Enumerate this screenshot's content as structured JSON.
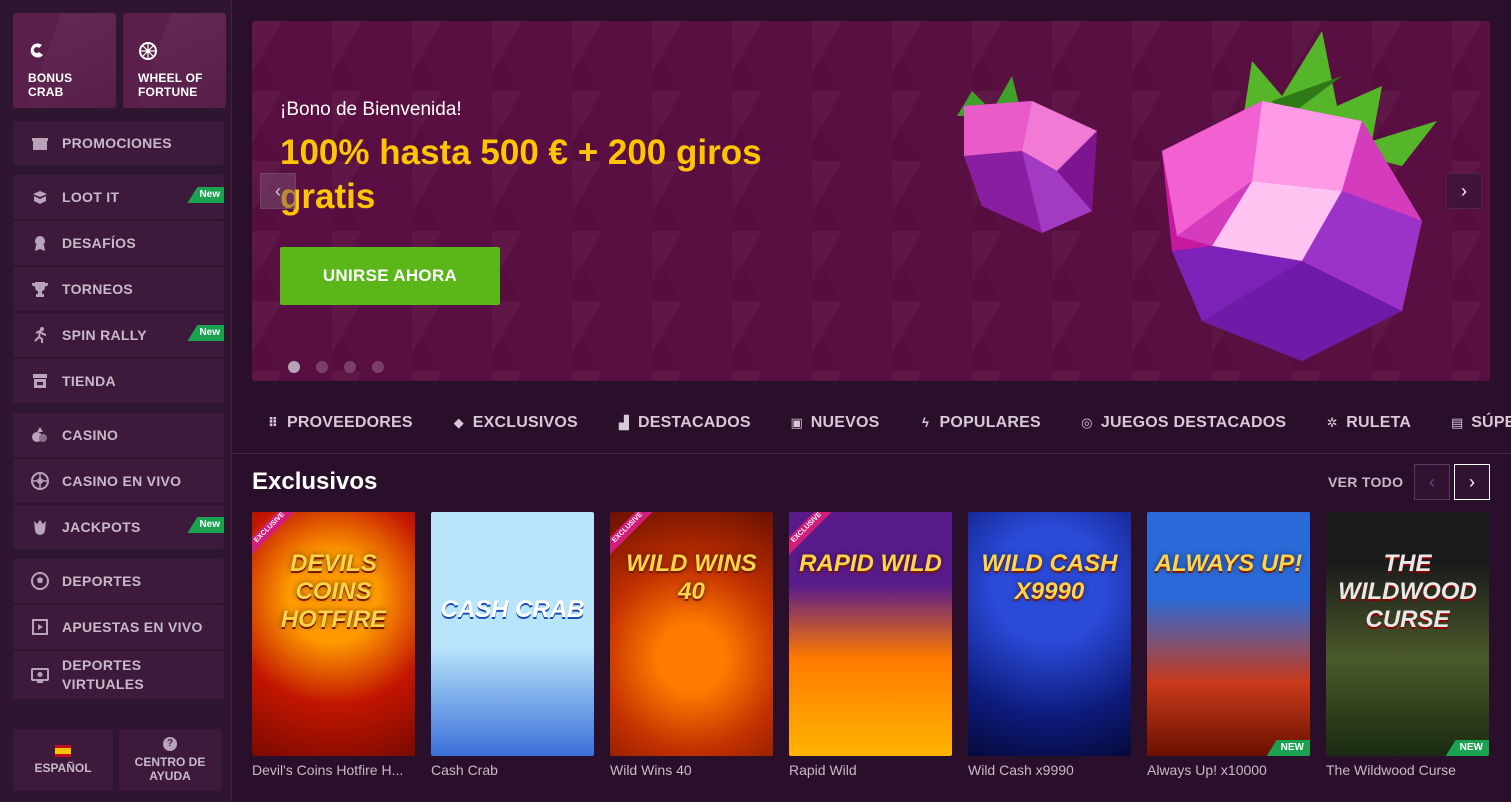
{
  "sidebar": {
    "top_tiles": [
      {
        "label": "BONUS CRAB",
        "icon": "crab-claw-icon"
      },
      {
        "label": "WHEEL OF FORTUNE",
        "icon": "wheel-icon"
      }
    ],
    "groups": [
      [
        {
          "label": "PROMOCIONES",
          "icon": "gift-box-icon"
        }
      ],
      [
        {
          "label": "LOOT IT",
          "icon": "loot-box-icon",
          "badge": "New"
        },
        {
          "label": "DESAFÍOS",
          "icon": "medal-icon"
        },
        {
          "label": "TORNEOS",
          "icon": "trophy-icon"
        },
        {
          "label": "SPIN RALLY",
          "icon": "runner-icon",
          "badge": "New"
        },
        {
          "label": "TIENDA",
          "icon": "shop-icon"
        }
      ],
      [
        {
          "label": "CASINO",
          "icon": "casino-icon"
        },
        {
          "label": "CASINO EN VIVO",
          "icon": "roulette-icon"
        },
        {
          "label": "JACKPOTS",
          "icon": "jackpot-icon",
          "badge": "New"
        }
      ],
      [
        {
          "label": "DEPORTES",
          "icon": "soccer-ball-icon"
        },
        {
          "label": "APUESTAS EN VIVO",
          "icon": "live-play-icon"
        },
        {
          "label": "DEPORTES VIRTUALES",
          "icon": "virtual-sports-icon"
        }
      ]
    ],
    "bottom": {
      "language": "ESPAÑOL",
      "help": "CENTRO DE AYUDA",
      "help_glyph": "?"
    }
  },
  "hero": {
    "subtitle": "¡Bono de Bienvenida!",
    "headline": "100% hasta 500 € + 200 giros gratis",
    "cta": "UNIRSE AHORA",
    "prev": "‹",
    "next": "›",
    "slides_total": 4,
    "active_slide": 1
  },
  "categories": [
    {
      "label": "PROVEEDORES",
      "icon": "grid-dots-icon"
    },
    {
      "label": "EXCLUSIVOS",
      "icon": "diamond-icon"
    },
    {
      "label": "DESTACADOS",
      "icon": "podium-icon"
    },
    {
      "label": "NUEVOS",
      "icon": "star-box-icon"
    },
    {
      "label": "POPULARES",
      "icon": "lightning-icon"
    },
    {
      "label": "JUEGOS DESTACADOS",
      "icon": "target-icon"
    },
    {
      "label": "RULETA",
      "icon": "roulette-icon"
    },
    {
      "label": "SÚPER SI",
      "icon": "slot-machine-icon"
    }
  ],
  "section": {
    "title": "Exclusivos",
    "see_all": "VER TODO",
    "prev": "‹",
    "next": "›"
  },
  "games": [
    {
      "name": "Devil's Coins Hotfire H...",
      "art": "DEVILS COINS HOTFIRE",
      "ribbon": "EXCLUSIVE"
    },
    {
      "name": "Cash Crab",
      "art": "CASH CRAB"
    },
    {
      "name": "Wild Wins 40",
      "art": "WILD WINS 40",
      "ribbon": "EXCLUSIVE"
    },
    {
      "name": "Rapid Wild",
      "art": "RAPID WILD",
      "ribbon": "EXCLUSIVE"
    },
    {
      "name": "Wild Cash x9990",
      "art": "WILD CASH X9990"
    },
    {
      "name": "Always Up! x10000",
      "art": "ALWAYS UP!",
      "badge": "NEW"
    },
    {
      "name": "The Wildwood Curse",
      "art": "THE WILDWOOD CURSE",
      "badge": "NEW"
    }
  ],
  "colors": {
    "accent_yellow": "#ffc500",
    "cta_green": "#5ab619",
    "badge_green": "#1aa251",
    "background": "#2a0f2a"
  }
}
